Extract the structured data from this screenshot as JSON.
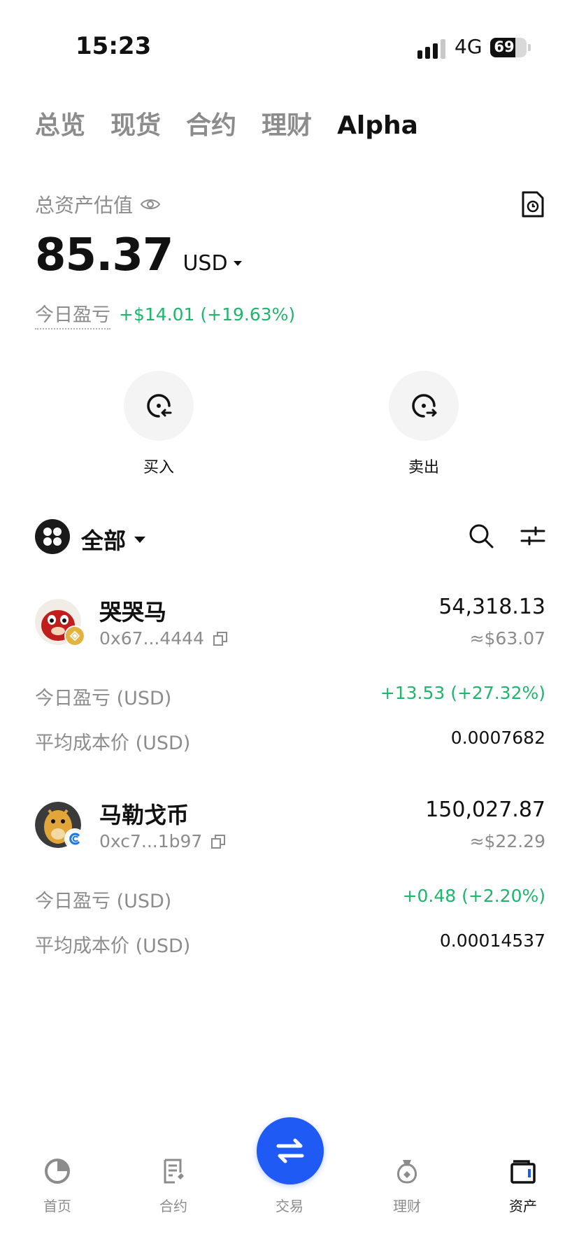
{
  "status_bar": {
    "time": "15:23",
    "network": "4G",
    "battery_level": "69",
    "battery_fraction": 0.69
  },
  "top_tabs": [
    {
      "label": "总览",
      "active": false
    },
    {
      "label": "现货",
      "active": false
    },
    {
      "label": "合约",
      "active": false
    },
    {
      "label": "理财",
      "active": false
    },
    {
      "label": "Alpha",
      "active": true
    }
  ],
  "summary": {
    "label": "总资产估值",
    "balance": "85.37",
    "currency": "USD",
    "pnl_label": "今日盈亏",
    "pnl_value": "+$14.01 (+19.63%)"
  },
  "actions": {
    "buy_label": "买入",
    "sell_label": "卖出"
  },
  "filter": {
    "label": "全部"
  },
  "tokens": [
    {
      "name": "哭哭马",
      "address": "0x67...4444",
      "amount": "54,318.13",
      "usd_value": "≈$63.07",
      "pnl_label": "今日盈亏 (USD)",
      "pnl_value": "+13.53 (+27.32%)",
      "cost_label": "平均成本价 (USD)",
      "cost_value": "0.0007682"
    },
    {
      "name": "马勒戈币",
      "address": "0xc7...1b97",
      "amount": "150,027.87",
      "usd_value": "≈$22.29",
      "pnl_label": "今日盈亏 (USD)",
      "pnl_value": "+0.48 (+2.20%)",
      "cost_label": "平均成本价 (USD)",
      "cost_value": "0.00014537"
    }
  ],
  "bottom_nav": [
    {
      "label": "首页",
      "icon": "home-icon",
      "active": false
    },
    {
      "label": "合约",
      "icon": "futures-icon",
      "active": false
    },
    {
      "label": "交易",
      "icon": "trade-icon",
      "active": false
    },
    {
      "label": "理财",
      "icon": "earn-icon",
      "active": false
    },
    {
      "label": "资产",
      "icon": "assets-icon",
      "active": true
    }
  ],
  "colors": {
    "positive": "#1fb56b",
    "accent": "#1f5af5",
    "muted": "#8c8c8c"
  }
}
